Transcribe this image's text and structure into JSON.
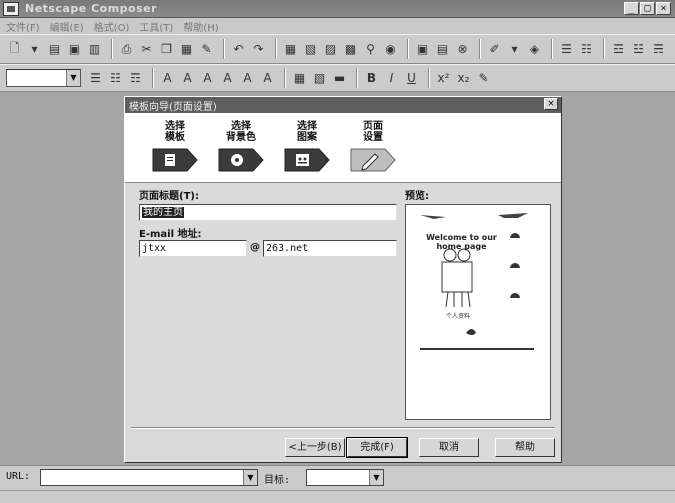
{
  "app": {
    "title": "Netscape Composer"
  },
  "menu": [
    "文件(F)",
    "编辑(E)",
    "格式(O)",
    "工具(T)",
    "帮助(H)"
  ],
  "window_buttons": [
    "_",
    "□",
    "×"
  ],
  "dialog": {
    "title": "模板向导(页面设置)",
    "steps": [
      {
        "label": "选择\n模板"
      },
      {
        "label": "选择\n背景色"
      },
      {
        "label": "选择\n图案"
      },
      {
        "label": "页面\n设置"
      }
    ],
    "page_title_label": "页面标题(T):",
    "page_title_value": "我的主页",
    "email_label": "E-mail 地址:",
    "email_user": "jtxx",
    "email_at": "@",
    "email_domain": "263.net",
    "preview_label": "预览:",
    "preview_welcome": "Welcome to our home page",
    "preview_caption": "个人资料",
    "buttons": {
      "back": "<上一步(B)",
      "finish": "完成(F)",
      "cancel": "取消",
      "help": "帮助"
    }
  },
  "statusbar": {
    "url_label": "URL:",
    "url_value": "",
    "target_label": "目标:",
    "target_value": ""
  },
  "colors": {
    "title_bar": "#7a7a7a",
    "dialog_title": "#5e5e5e",
    "workspace": "#a5a5a5"
  }
}
